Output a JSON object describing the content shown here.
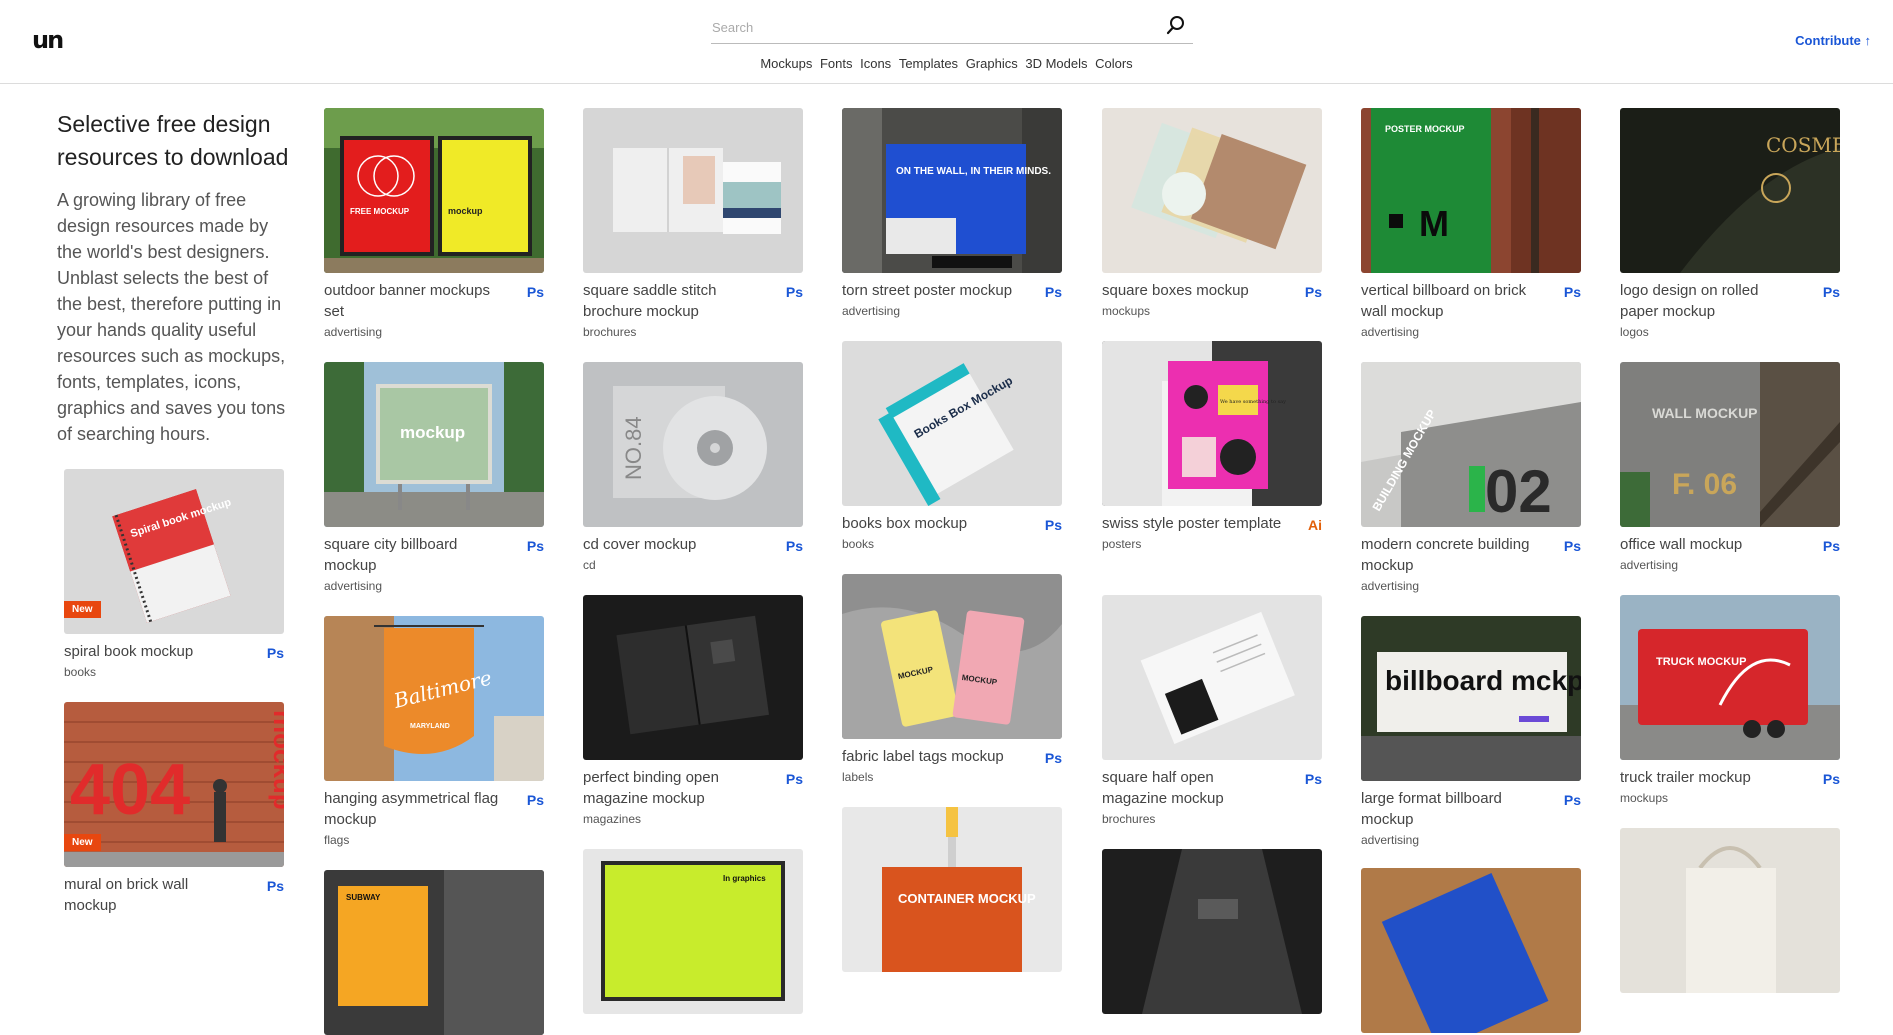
{
  "header": {
    "logo": "un",
    "search_placeholder": "Search",
    "nav": [
      "Mockups",
      "Fonts",
      "Icons",
      "Templates",
      "Graphics",
      "3D Models",
      "Colors"
    ],
    "contribute": "Contribute ↑"
  },
  "intro": {
    "title": "Selective free design resources to download",
    "text": "A growing library of free design resources made by the world's best designers. Unblast selects the best of the best, therefore putting in your hands quality useful resources such as mockups, fonts, templates, icons, graphics and saves you tons of searching hours."
  },
  "badge_new": "New",
  "colors": {
    "accent": "#1a56d6",
    "ai": "#e2600a",
    "new": "#e8470f"
  },
  "cards": [
    {
      "title": "spiral book mockup",
      "category": "books",
      "badge": "Ps"
    },
    {
      "title": "mural on brick wall mockup",
      "category": "",
      "badge": "Ps"
    },
    {
      "title": "outdoor banner mockups set",
      "category": "advertising",
      "badge": "Ps"
    },
    {
      "title": "square city billboard mockup",
      "category": "advertising",
      "badge": "Ps"
    },
    {
      "title": "hanging asymmetrical flag mockup",
      "category": "flags",
      "badge": "Ps"
    },
    {
      "title": "",
      "category": "",
      "badge": ""
    },
    {
      "title": "square saddle stitch brochure mockup",
      "category": "brochures",
      "badge": "Ps"
    },
    {
      "title": "cd cover mockup",
      "category": "cd",
      "badge": "Ps"
    },
    {
      "title": "perfect binding open magazine mockup",
      "category": "magazines",
      "badge": "Ps"
    },
    {
      "title": "",
      "category": "",
      "badge": ""
    },
    {
      "title": "torn street poster mockup",
      "category": "advertising",
      "badge": "Ps"
    },
    {
      "title": "books box mockup",
      "category": "books",
      "badge": "Ps"
    },
    {
      "title": "fabric label tags mockup",
      "category": "labels",
      "badge": "Ps"
    },
    {
      "title": "",
      "category": "",
      "badge": ""
    },
    {
      "title": "square boxes mockup",
      "category": "mockups",
      "badge": "Ps"
    },
    {
      "title": "swiss style poster template",
      "category": "posters",
      "badge": "Ai"
    },
    {
      "title": "square half open magazine mockup",
      "category": "brochures",
      "badge": "Ps"
    },
    {
      "title": "",
      "category": "",
      "badge": ""
    },
    {
      "title": "vertical billboard on brick wall mockup",
      "category": "advertising",
      "badge": "Ps"
    },
    {
      "title": "modern concrete building mockup",
      "category": "advertising",
      "badge": "Ps"
    },
    {
      "title": "large format billboard mockup",
      "category": "advertising",
      "badge": "Ps"
    },
    {
      "title": "",
      "category": "",
      "badge": ""
    },
    {
      "title": "logo design on rolled paper mockup",
      "category": "logos",
      "badge": "Ps"
    },
    {
      "title": "office wall mockup",
      "category": "advertising",
      "badge": "Ps"
    },
    {
      "title": "truck trailer mockup",
      "category": "mockups",
      "badge": "Ps"
    },
    {
      "title": "",
      "category": "",
      "badge": ""
    }
  ],
  "thumb_text": {
    "spiral": "Spiral book mockup",
    "mural": "404",
    "mural_side": "mockup",
    "banner_left": "FREE MOCKUP",
    "banner_right": "mockup",
    "city": "mockup",
    "flag": "Baltimore",
    "flag_sub": "MARYLAND",
    "subway": "SUBWAY",
    "cd": "NO.84",
    "mag_bottom": "In graphics",
    "torn": "ON THE WALL, IN THEIR MINDS.",
    "books_box": "Books Box Mockup",
    "tag": "MOCKUP",
    "container": "CONTAINER MOCKUP",
    "swiss": "We have something to say",
    "vbillboard": "POSTER MOCKUP",
    "vbillboard_m": "M",
    "building": "BUILDING MOCKUP",
    "building_num": "02",
    "large_billboard": "billboard mckp",
    "logo_paper": "COSME",
    "office": "WALL MOCKUP",
    "office_num": "F. 06",
    "truck": "TRUCK MOCKUP"
  }
}
